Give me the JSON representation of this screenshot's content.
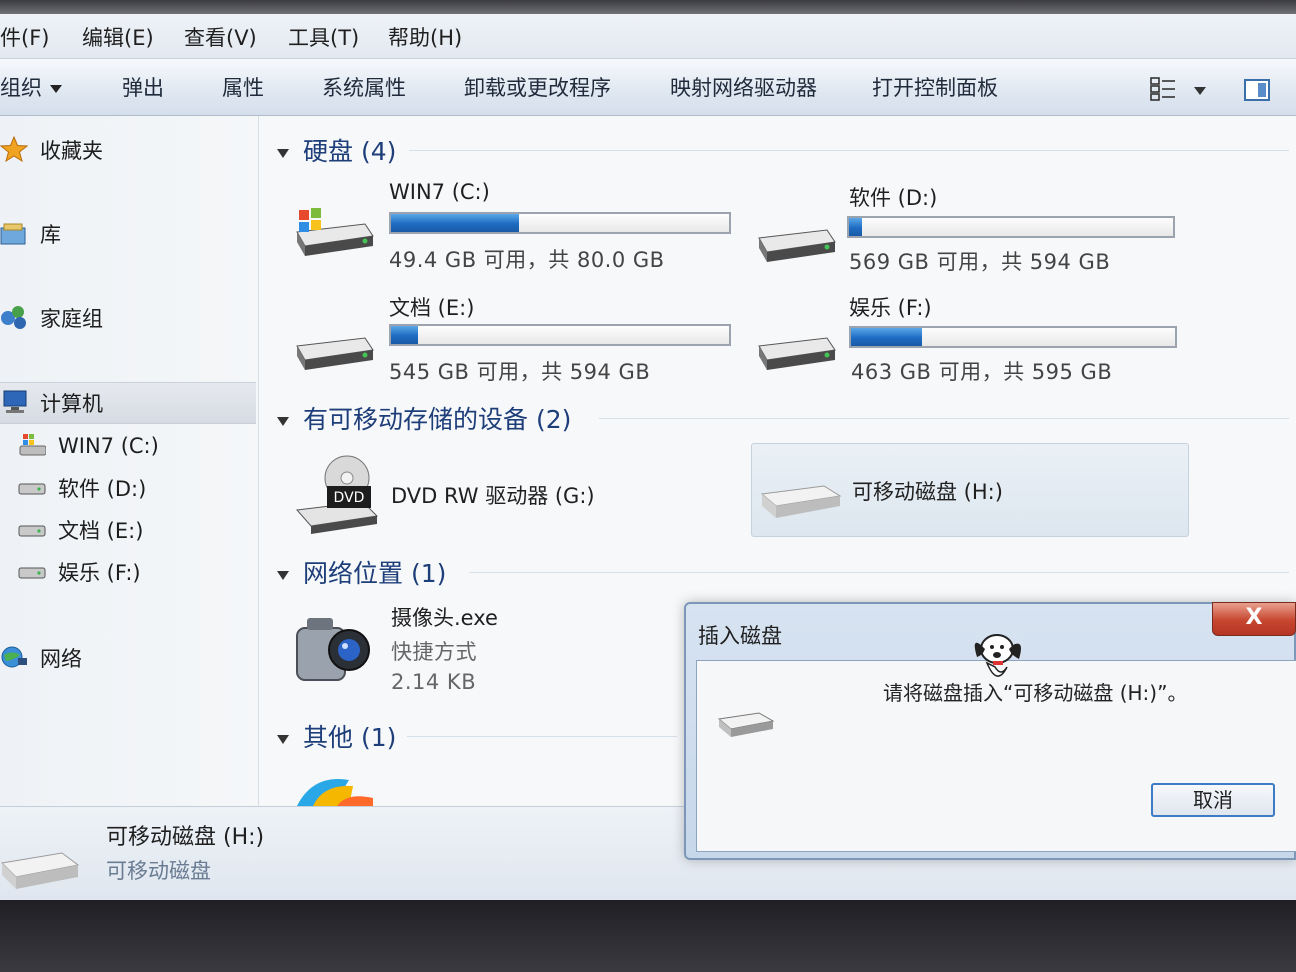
{
  "menu": {
    "file": "件(F)",
    "edit": "编辑(E)",
    "view": "查看(V)",
    "tools": "工具(T)",
    "help": "帮助(H)"
  },
  "toolbar": {
    "organize": "组织",
    "eject": "弹出",
    "properties": "属性",
    "system_properties": "系统属性",
    "uninstall": "卸载或更改程序",
    "map_drive": "映射网络驱动器",
    "control_panel": "打开控制面板"
  },
  "nav": {
    "favorites": "收藏夹",
    "libraries": "库",
    "homegroup": "家庭组",
    "computer": "计算机",
    "drives": [
      "WIN7 (C:)",
      "软件 (D:)",
      "文档 (E:)",
      "娱乐 (F:)"
    ],
    "network": "网络"
  },
  "groups": {
    "hdd": "硬盘 (4)",
    "removable": "有可移动存储的设备 (2)",
    "network": "网络位置 (1)",
    "other": "其他 (1)"
  },
  "drives": [
    {
      "name": "WIN7 (C:)",
      "free": "49.4 GB 可用，共 80.0 GB",
      "used_fraction": 0.38
    },
    {
      "name": "软件 (D:)",
      "free": "569 GB 可用，共 594 GB",
      "used_fraction": 0.04
    },
    {
      "name": "文档 (E:)",
      "free": "545 GB 可用，共 594 GB",
      "used_fraction": 0.08
    },
    {
      "name": "娱乐 (F:)",
      "free": "463 GB 可用，共 595 GB",
      "used_fraction": 0.22
    }
  ],
  "removable_devices": {
    "dvd": "DVD RW 驱动器 (G:)",
    "dvd_badge": "DVD",
    "usb": "可移动磁盘 (H:)"
  },
  "network_item": {
    "name": "摄像头.exe",
    "type": "快捷方式",
    "size": "2.14 KB"
  },
  "details": {
    "name": "可移动磁盘 (H:)",
    "type": "可移动磁盘"
  },
  "dialog": {
    "title": "插入磁盘",
    "close": "X",
    "message": "请将磁盘插入“可移动磁盘 (H:)”。",
    "cancel": "取消"
  },
  "colors": {
    "bar_fill": "#1e6cc2",
    "header_text": "#1e3e7a",
    "close_button": "#c7462f"
  }
}
